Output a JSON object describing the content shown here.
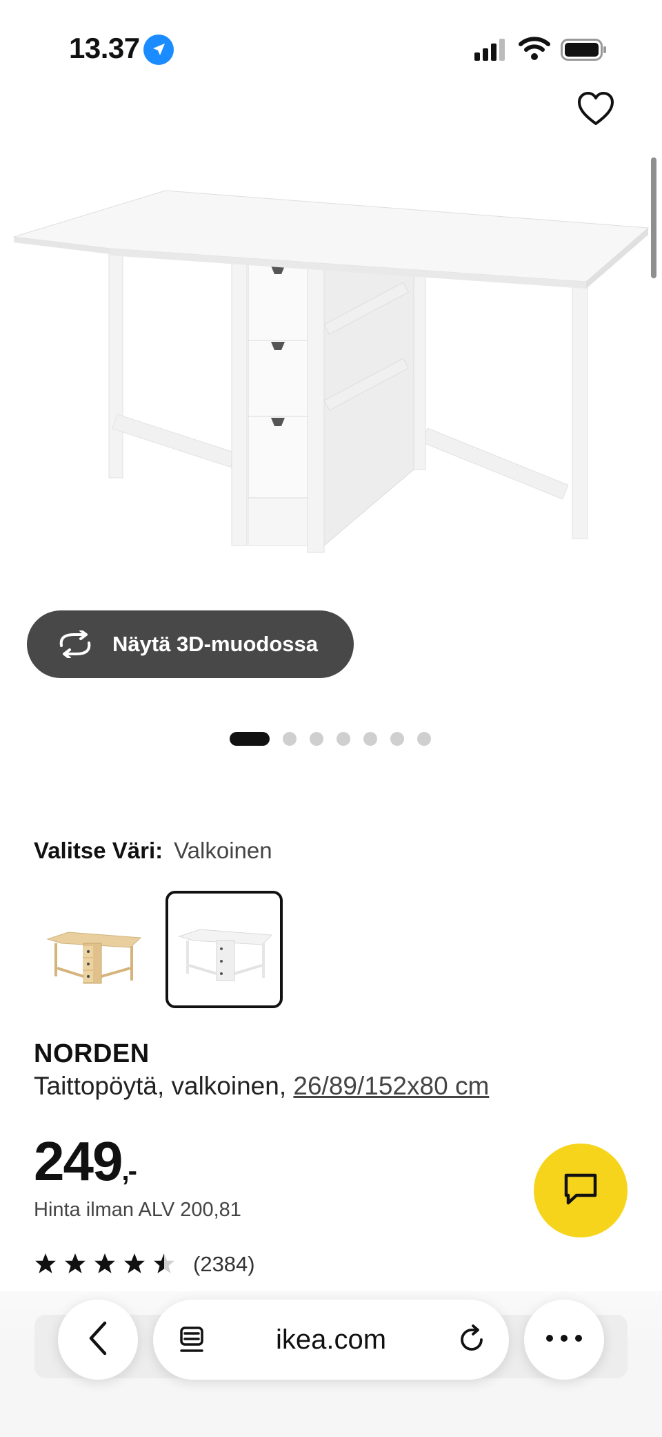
{
  "status": {
    "time": "13.37"
  },
  "product": {
    "view3d_label": "Näytä 3D-muodossa",
    "image_count": 7,
    "active_image": 1,
    "color_label": "Valitse Väri:",
    "color_value": "Valkoinen",
    "swatches": [
      {
        "name": "koivu",
        "selected": false
      },
      {
        "name": "valkoinen",
        "selected": true
      }
    ],
    "name": "NORDEN",
    "description": "Taittopöytä, valkoinen,",
    "dimensions": "26/89/152x80 cm",
    "price": "249",
    "price_suffix": ",-",
    "vat_text": "Hinta ilman ALV 200,81",
    "rating": 4.5,
    "rating_count": "(2384)"
  },
  "browser": {
    "url": "ikea.com"
  },
  "colors": {
    "chat": "#f7d41c",
    "button3d": "#484848"
  }
}
